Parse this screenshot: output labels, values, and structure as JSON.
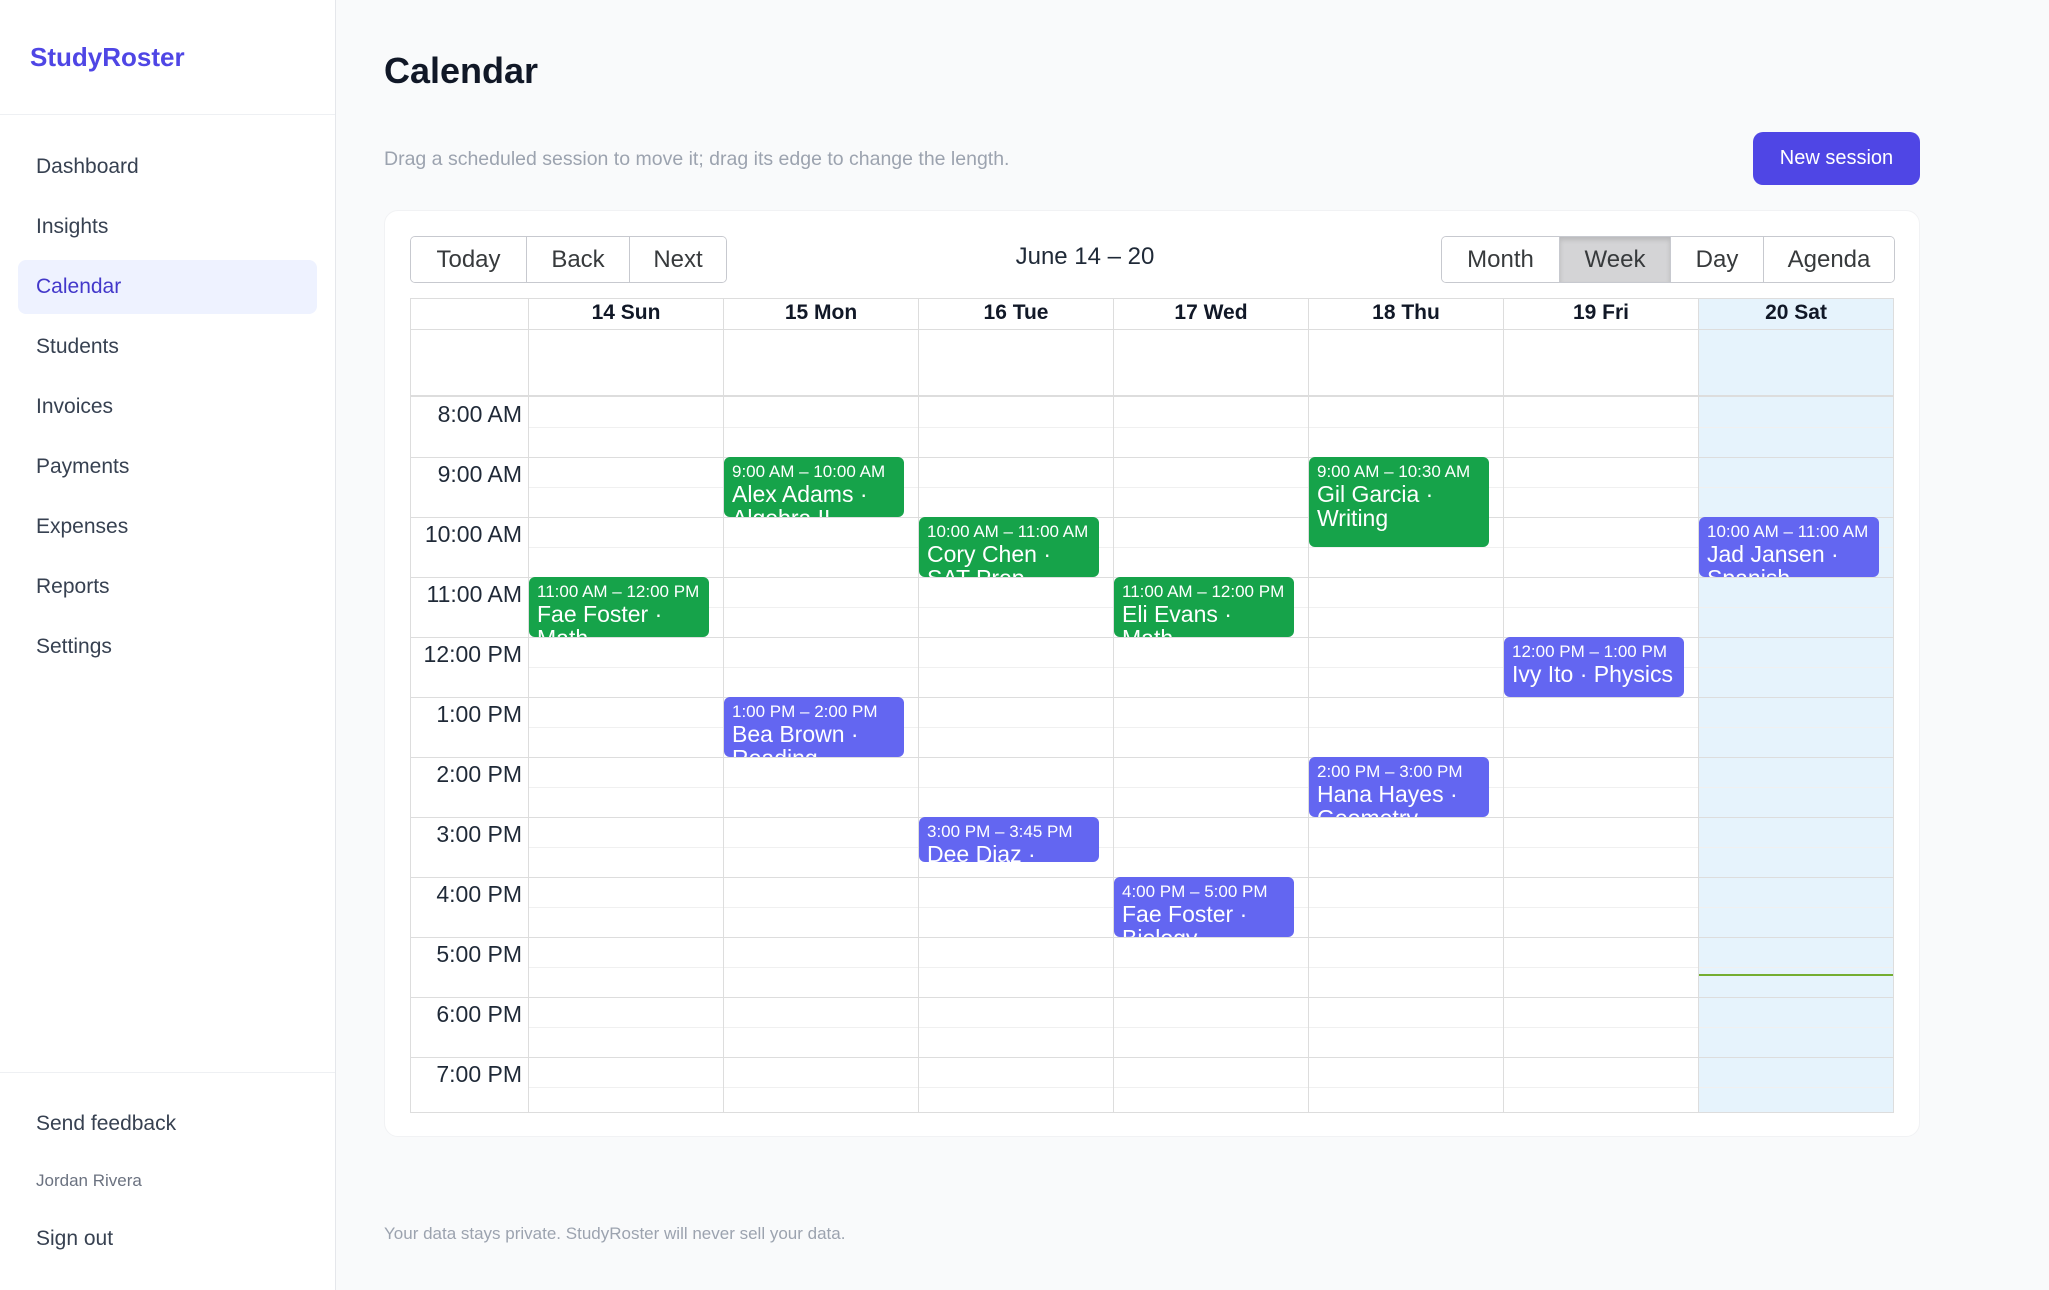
{
  "app": {
    "brand": "StudyRoster"
  },
  "sidebar": {
    "items": [
      {
        "label": "Dashboard"
      },
      {
        "label": "Insights"
      },
      {
        "label": "Calendar"
      },
      {
        "label": "Students"
      },
      {
        "label": "Invoices"
      },
      {
        "label": "Payments"
      },
      {
        "label": "Expenses"
      },
      {
        "label": "Reports"
      },
      {
        "label": "Settings"
      }
    ],
    "active": "Calendar",
    "feedback_label": "Send feedback",
    "user_name": "Jordan Rivera",
    "signout_label": "Sign out"
  },
  "page": {
    "title": "Calendar",
    "hint": "Drag a scheduled session to move it; drag its edge to change the length.",
    "new_session_label": "New session",
    "footer": "Your data stays private. StudyRoster will never sell your data."
  },
  "toolbar": {
    "today_label": "Today",
    "back_label": "Back",
    "next_label": "Next",
    "range_label": "June 14 – 20",
    "views": [
      {
        "label": "Month"
      },
      {
        "label": "Week"
      },
      {
        "label": "Day"
      },
      {
        "label": "Agenda"
      }
    ],
    "active_view": "Week"
  },
  "calendar": {
    "days": [
      {
        "label": "14 Sun"
      },
      {
        "label": "15 Mon"
      },
      {
        "label": "16 Tue"
      },
      {
        "label": "17 Wed"
      },
      {
        "label": "18 Thu"
      },
      {
        "label": "19 Fri"
      },
      {
        "label": "20 Sat"
      }
    ],
    "today": "20 Sat",
    "hours": [
      "8:00 AM",
      "9:00 AM",
      "10:00 AM",
      "11:00 AM",
      "12:00 PM",
      "1:00 PM",
      "2:00 PM",
      "3:00 PM",
      "4:00 PM",
      "5:00 PM",
      "6:00 PM",
      "7:00 PM"
    ],
    "current_time_line": "5:20 PM",
    "events": [
      {
        "day": "15 Mon",
        "time": "9:00 AM – 10:00 AM",
        "title": "Alex Adams · Algebra II",
        "color": "#16a34a"
      },
      {
        "day": "16 Tue",
        "time": "10:00 AM – 11:00 AM",
        "title": "Cory Chen · SAT Prep",
        "color": "#16a34a"
      },
      {
        "day": "14 Sun",
        "time": "11:00 AM – 12:00 PM",
        "title": "Fae Foster · Math",
        "color": "#16a34a"
      },
      {
        "day": "17 Wed",
        "time": "11:00 AM – 12:00 PM",
        "title": "Eli Evans · Math",
        "color": "#16a34a"
      },
      {
        "day": "18 Thu",
        "time": "9:00 AM – 10:30 AM",
        "title": "Gil Garcia · Writing",
        "color": "#16a34a"
      },
      {
        "day": "20 Sat",
        "time": "10:00 AM – 11:00 AM",
        "title": "Jad Jansen · Spanish",
        "color": "#6366f1"
      },
      {
        "day": "19 Fri",
        "time": "12:00 PM – 1:00 PM",
        "title": "Ivy Ito · Physics",
        "color": "#6366f1"
      },
      {
        "day": "15 Mon",
        "time": "1:00 PM – 2:00 PM",
        "title": "Bea Brown · Reading",
        "color": "#6366f1"
      },
      {
        "day": "18 Thu",
        "time": "2:00 PM – 3:00 PM",
        "title": "Hana Hayes · Geometry",
        "color": "#6366f1"
      },
      {
        "day": "16 Tue",
        "time": "3:00 PM – 3:45 PM",
        "title": "Dee Diaz · Chemistry",
        "color": "#6366f1"
      },
      {
        "day": "17 Wed",
        "time": "4:00 PM – 5:00 PM",
        "title": "Fae Foster · Biology",
        "color": "#6366f1"
      }
    ]
  },
  "colors": {
    "brand": "#4f46e5",
    "session_green": "#16a34a",
    "session_purple": "#6366f1",
    "today_bg": "#e6f3fc",
    "now_line": "#74ad31"
  }
}
